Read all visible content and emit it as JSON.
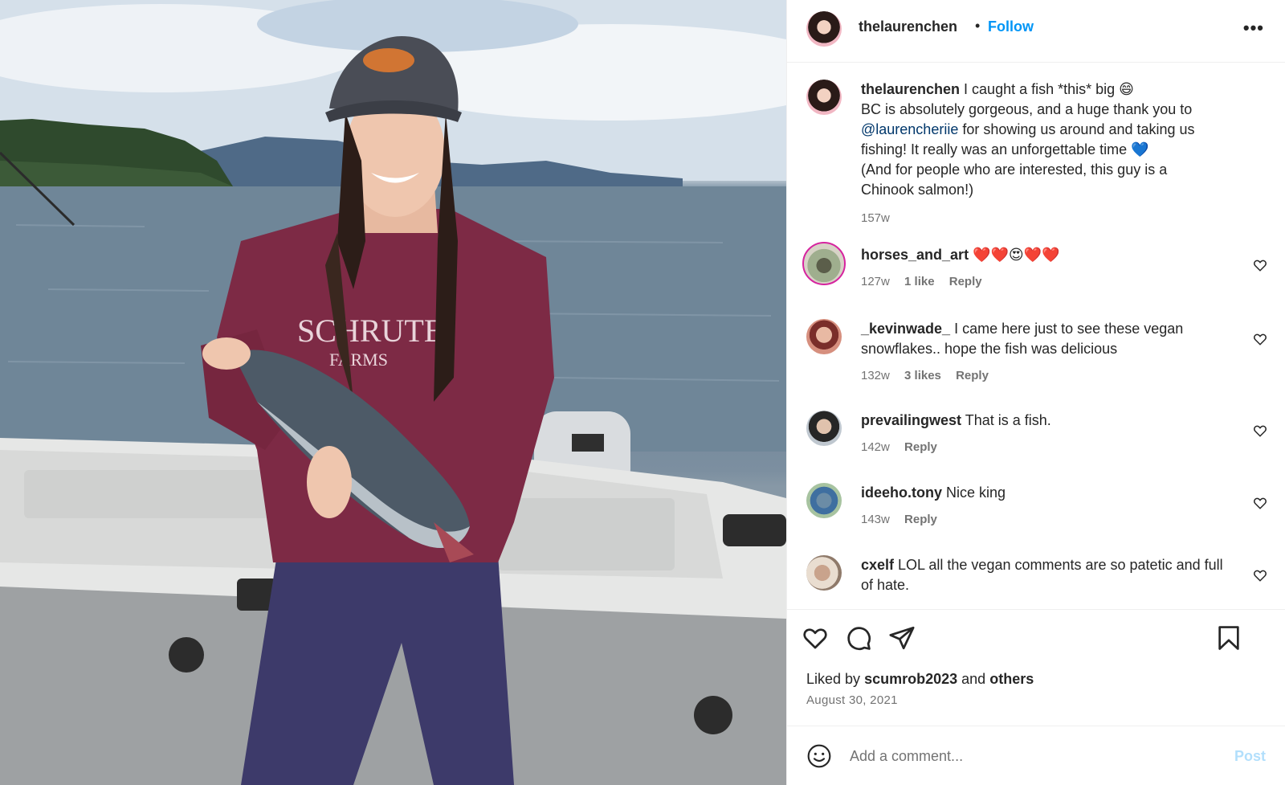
{
  "post": {
    "username": "thelaurenchen",
    "follow_label": "Follow",
    "separator": "•",
    "more_icon": "more-horizontal-icon"
  },
  "caption": {
    "username": "thelaurenchen",
    "line1": "I caught a fish *this* big 😄",
    "line2": "BC is absolutely gorgeous, and a huge thank you to",
    "mention": "@laurencheriie",
    "line3_rest": "for showing us around and taking us",
    "line4": "fishing! It really was an unforgettable time 💙",
    "line5": "(And for people who are interested, this guy is a",
    "line6": "Chinook salmon!)",
    "time": "157w"
  },
  "comments": [
    {
      "username": "horses_and_art",
      "text": "❤️❤️😍❤️❤️",
      "time": "127w",
      "likes": "1 like",
      "reply": "Reply"
    },
    {
      "username": "_kevinwade_",
      "text": "I came here just to see these vegan snowflakes.. hope the fish was delicious",
      "time": "132w",
      "likes": "3 likes",
      "reply": "Reply"
    },
    {
      "username": "prevailingwest",
      "text": "That is a fish.",
      "time": "142w",
      "likes": "",
      "reply": "Reply"
    },
    {
      "username": "ideeho.tony",
      "text": "Nice king",
      "time": "143w",
      "likes": "",
      "reply": "Reply"
    },
    {
      "username": "cxelf",
      "text": "LOL all the vegan comments are so patetic and full of hate.",
      "time": "",
      "likes": "",
      "reply": ""
    }
  ],
  "actions": {
    "like_icon": "heart-icon",
    "comment_icon": "comment-icon",
    "share_icon": "send-icon",
    "save_icon": "bookmark-icon"
  },
  "likes": {
    "prefix": "Liked by",
    "user": "scumrob2023",
    "middle": "and",
    "others": "others"
  },
  "date": "August 30, 2021",
  "add_comment": {
    "placeholder": "Add a comment...",
    "post_label": "Post",
    "emoji_icon": "emoji-smile-icon"
  },
  "colors": {
    "accent": "#0095f6",
    "post_disabled": "#b2dffc",
    "muted": "#737373",
    "text": "#262626"
  }
}
